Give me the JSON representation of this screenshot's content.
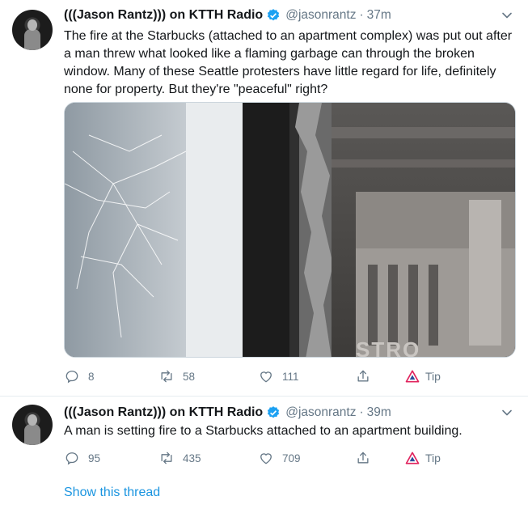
{
  "tweets": [
    {
      "author_name": "(((Jason Rantz))) on KTTH Radio",
      "handle": "@jasonrantz",
      "separator": "·",
      "time": "37m",
      "text": "The fire at the Starbucks (attached to an apartment complex) was put out after a man threw what looked like a flaming garbage can through the broken window. Many of these Seattle protesters have little regard for life, definitely none for property. But they're \"peaceful\" right?",
      "media_overlay_text": "STRO",
      "reply_count": "8",
      "retweet_count": "58",
      "like_count": "111",
      "tip_label": "Tip"
    },
    {
      "author_name": "(((Jason Rantz))) on KTTH Radio",
      "handle": "@jasonrantz",
      "separator": "·",
      "time": "39m",
      "text": "A man is setting fire to a Starbucks attached to an apartment building.",
      "reply_count": "95",
      "retweet_count": "435",
      "like_count": "709",
      "tip_label": "Tip"
    }
  ],
  "show_thread_label": "Show this thread",
  "icons": {
    "verified": "verified-badge-icon",
    "more": "chevron-down-icon",
    "reply": "reply-icon",
    "retweet": "retweet-icon",
    "like": "heart-icon",
    "share": "share-icon",
    "tip": "tip-icon"
  },
  "colors": {
    "accent": "#1b95e0",
    "verified": "#1da1f2",
    "muted": "#657786",
    "tip": "#e0245e"
  }
}
